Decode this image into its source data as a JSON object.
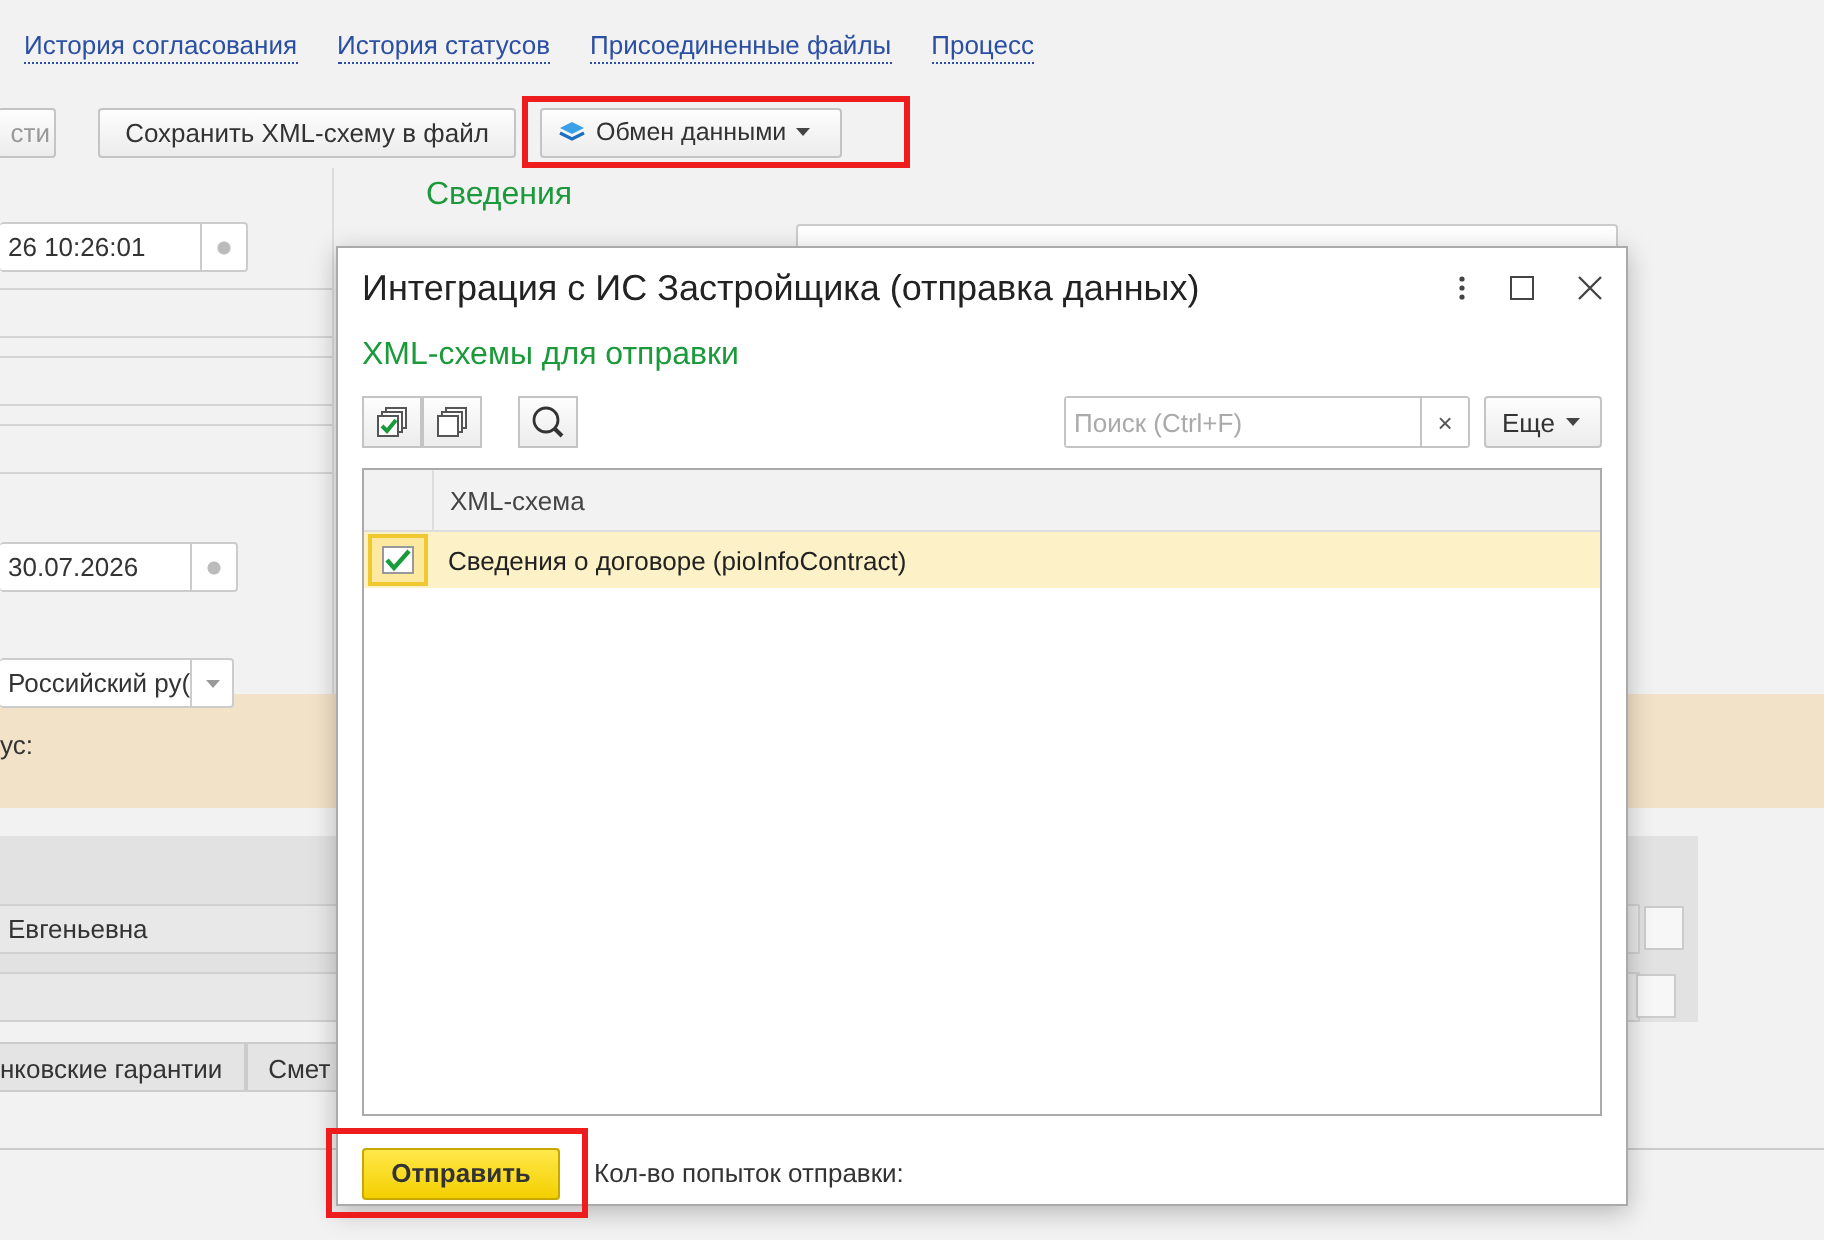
{
  "links": [
    "История согласования",
    "История статусов",
    "Присоединенные файлы",
    "Процесс"
  ],
  "toolbar": {
    "cut_button": "сти",
    "save_button": "Сохранить XML-схему в файл",
    "exchange_button": {
      "label": "Обмен данными",
      "highlighted": true
    }
  },
  "form": {
    "section_title": "Сведения",
    "datetime": "26 10:26:01",
    "date": "30.07.2026",
    "currency": "Российский ру(",
    "status_label": "ус:",
    "person": "Евгеньевна"
  },
  "tabs": [
    {
      "label": "нковские гарантии",
      "selected": false
    },
    {
      "label": "Смет",
      "selected": false
    }
  ],
  "dialog": {
    "title": "Интеграция с ИС Застройщика (отправка данных)",
    "subtitle": "XML-схемы для отправки",
    "search": {
      "placeholder": "Поиск (Ctrl+F)"
    },
    "clear": "×",
    "more_button": "Еще",
    "table": {
      "columns": [
        "XML-схема"
      ],
      "rows": [
        {
          "name": "Сведения о договоре (pioInfoContract)",
          "checked": true,
          "selected": true
        }
      ]
    },
    "send_button": {
      "label": "Отправить",
      "highlighted": true
    },
    "attempts_label": "Кол-во попыток отправки:"
  }
}
